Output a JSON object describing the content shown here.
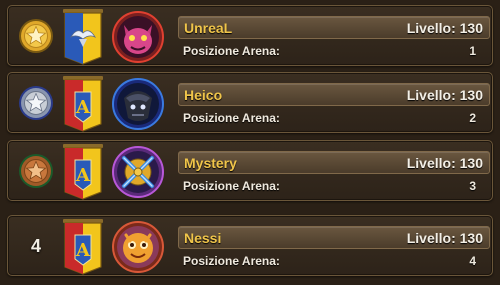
{
  "labels": {
    "level_prefix": "Livello:",
    "position_label": "Posizione Arena:"
  },
  "rows": [
    {
      "name": "UnreaL",
      "level": "130",
      "position": "1",
      "medal": "gold-medal-icon",
      "banner": "winged-crest-banner-icon",
      "avatar": "pink-demon-avatar-icon",
      "rank_text": ""
    },
    {
      "name": "Heico",
      "level": "130",
      "position": "2",
      "medal": "silver-medal-icon",
      "banner": "letter-a-banner-icon",
      "avatar": "dark-knight-avatar-icon",
      "rank_text": ""
    },
    {
      "name": "Mystery",
      "level": "130",
      "position": "3",
      "medal": "bronze-medal-icon",
      "banner": "letter-a-banner-icon",
      "avatar": "crossed-swords-avatar-icon",
      "rank_text": ""
    },
    {
      "name": "Nessi",
      "level": "130",
      "position": "4",
      "medal": "",
      "banner": "letter-a-banner-icon",
      "avatar": "orange-creature-avatar-icon",
      "rank_text": "4"
    }
  ],
  "colors": {
    "gold": "#f0c54a",
    "silver": "#c9ced6",
    "bronze": "#c8773c",
    "banner_yellow": "#f2c51c",
    "banner_blue": "#2a5ab8",
    "banner_red": "#c92a2a"
  }
}
